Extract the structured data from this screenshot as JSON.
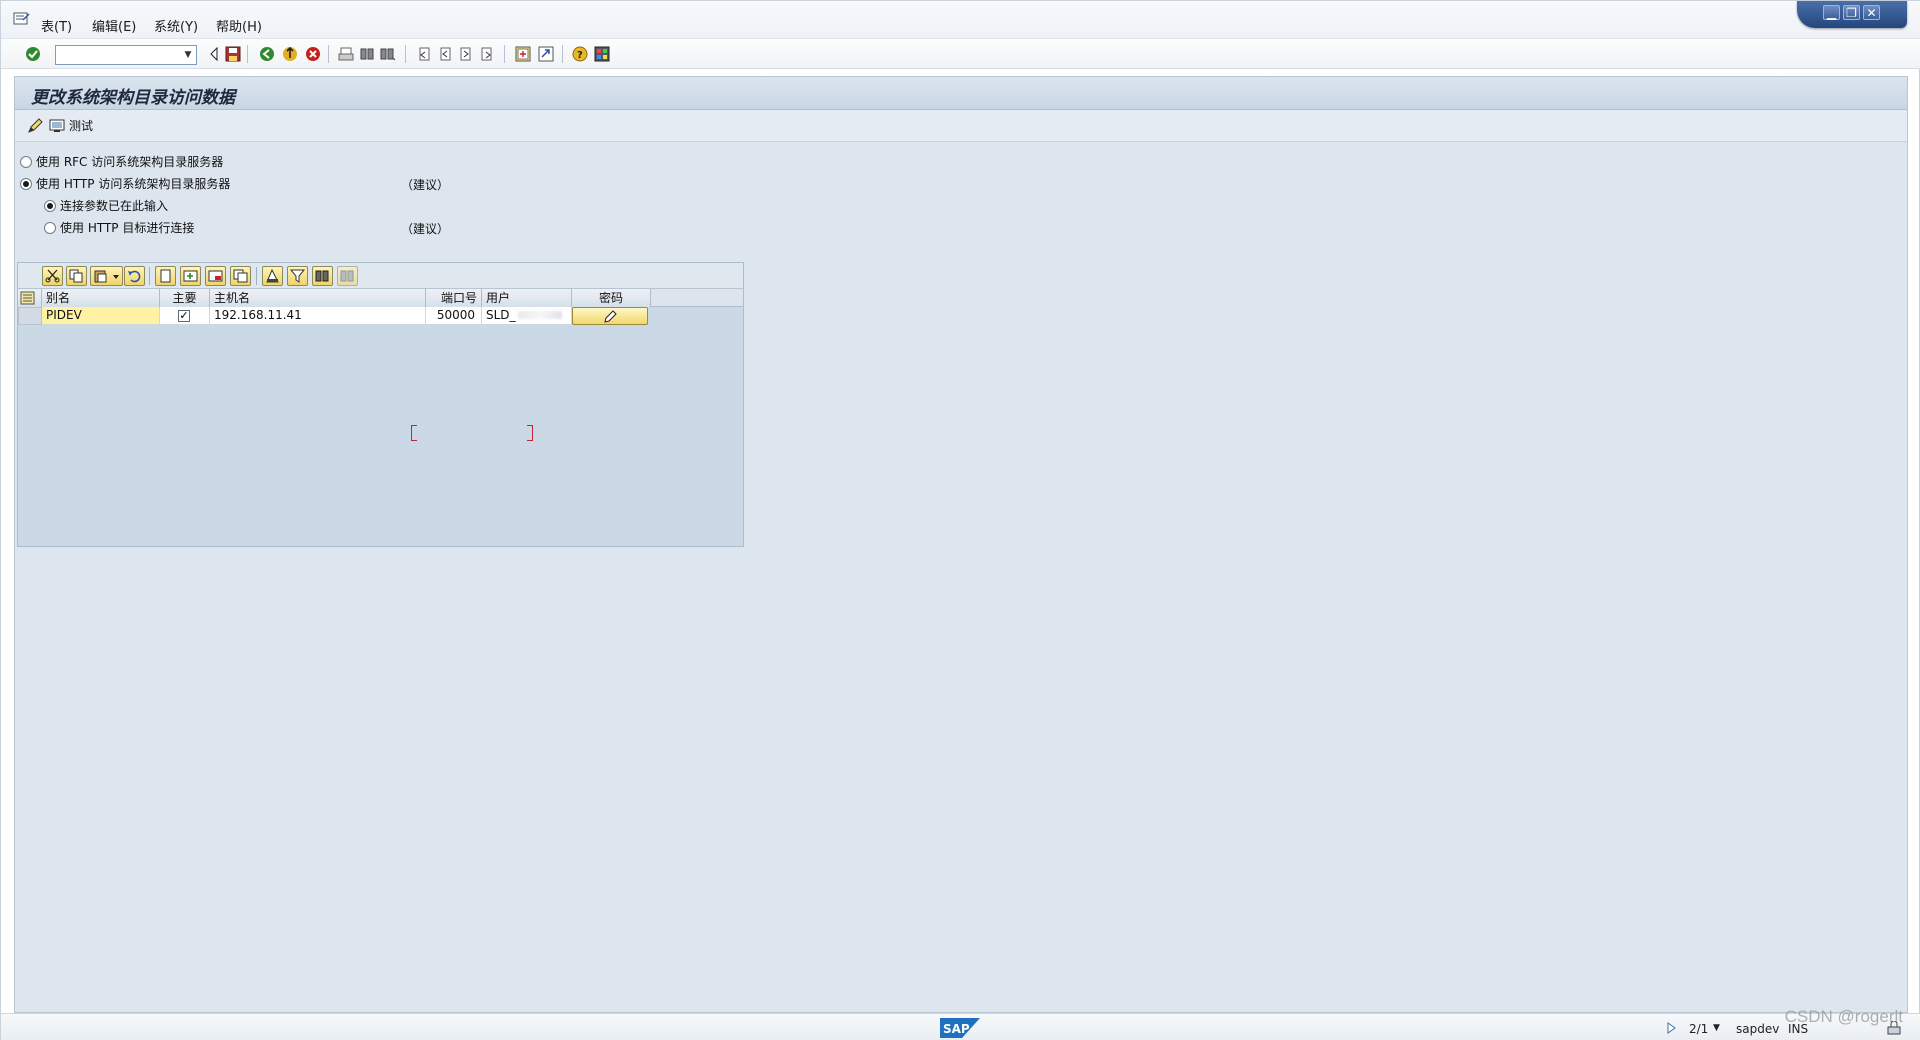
{
  "menubar": {
    "items": [
      {
        "label": "表(T)"
      },
      {
        "label": "编辑(E)"
      },
      {
        "label": "系统(Y)"
      },
      {
        "label": "帮助(H)"
      }
    ],
    "window_controls": [
      "minimize-icon",
      "restore-icon",
      "close-icon"
    ]
  },
  "systoolbar": {
    "command_value": "",
    "icons": [
      "enter-check-icon",
      "save-icon",
      "back-icon",
      "exit-icon",
      "cancel-icon",
      "print-icon",
      "find-icon",
      "find-next-icon",
      "first-page-icon",
      "previous-page-icon",
      "next-page-icon",
      "last-page-icon",
      "create-session-icon",
      "shortcut-icon",
      "help-icon",
      "layout-menu-icon"
    ]
  },
  "page": {
    "title": "更改系统架构目录访问数据",
    "app_toolbar": {
      "test_label": "测试"
    }
  },
  "options": {
    "rfc_label": "使用 RFC 访问系统架构目录服务器",
    "http_label": "使用 HTTP 访问系统架构目录服务器",
    "http_hint": "（建议）",
    "sub_direct_label": "连接参数已在此输入",
    "sub_dest_label": "使用 HTTP 目标进行连接",
    "sub_dest_hint": "（建议）",
    "selected": "http",
    "sub_selected": "direct"
  },
  "table": {
    "columns": [
      "别名",
      "主要",
      "主机名",
      "端口号",
      "用户",
      "密码"
    ],
    "rows": [
      {
        "alias": "PIDEV",
        "primary": "✓",
        "host": "192.168.11.41",
        "port": "50000",
        "user": "SLD_",
        "password_icon": "pencil-icon"
      }
    ],
    "toolbar_icons": [
      "cut-icon",
      "copy-icon",
      "paste-icon",
      "undo-icon",
      "new-row-icon",
      "insert-row-icon",
      "delete-row-icon",
      "copy-row-icon",
      "print-icon",
      "filter-icon",
      "find-icon",
      "find-next-icon"
    ]
  },
  "statusbar": {
    "session": "2/1",
    "system": "sapdev",
    "mode": "INS",
    "logo_text": "SAP"
  },
  "watermark": "CSDN @rogerlt"
}
